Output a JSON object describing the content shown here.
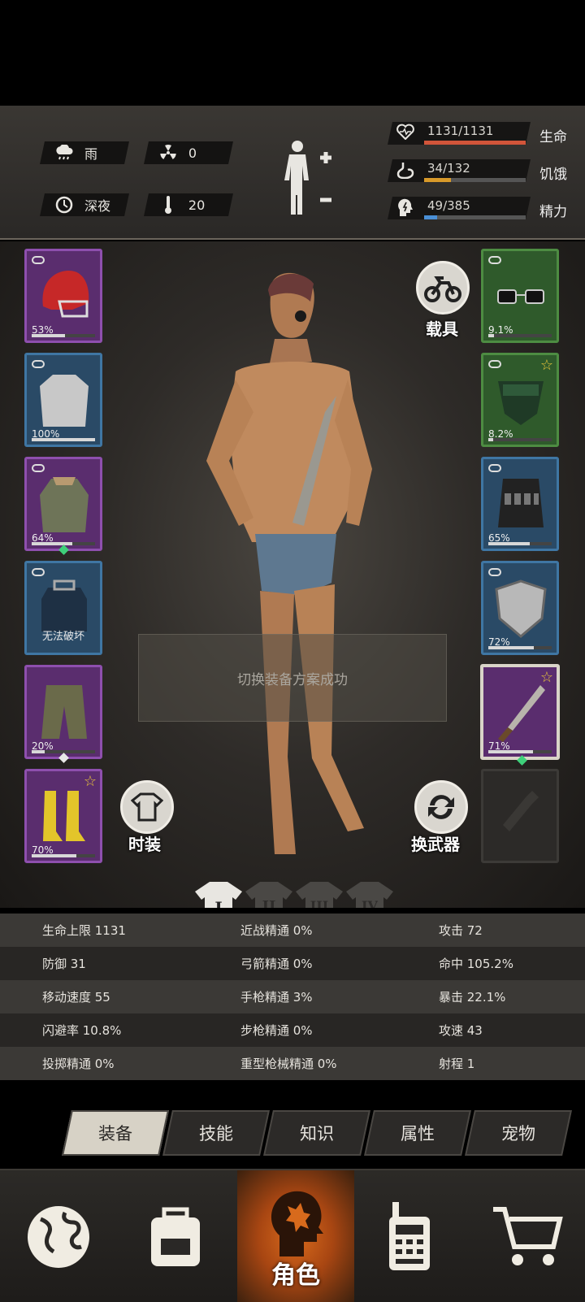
{
  "environment": {
    "weather": "雨",
    "radiation": "0",
    "time_of_day": "深夜",
    "temperature": "20"
  },
  "vitals": [
    {
      "label": "生命",
      "value": "1131/1131",
      "fraction": 1.0,
      "color": "#d2553a",
      "icon": "heart-icon"
    },
    {
      "label": "饥饿",
      "value": "34/132",
      "fraction": 0.26,
      "color": "#d89a2a",
      "icon": "stomach-icon"
    },
    {
      "label": "精力",
      "value": "49/385",
      "fraction": 0.13,
      "color": "#4a8fd6",
      "icon": "head-energy-icon"
    }
  ],
  "left_slots": [
    {
      "name": "helmet",
      "pct": "53%",
      "durability": 0.53,
      "rarity": "purple",
      "icon": "football-helmet-icon"
    },
    {
      "name": "shirt",
      "pct": "100%",
      "durability": 1.0,
      "rarity": "blue",
      "icon": "shirt-icon"
    },
    {
      "name": "jacket",
      "pct": "64%",
      "durability": 0.64,
      "rarity": "purple",
      "icon": "parka-icon"
    },
    {
      "name": "backpack",
      "pct": "",
      "text": "无法破坏",
      "rarity": "blue",
      "icon": "backpack-icon"
    },
    {
      "name": "pants",
      "pct": "20%",
      "durability": 0.2,
      "rarity": "purple",
      "icon": "pants-icon"
    },
    {
      "name": "boots",
      "pct": "70%",
      "durability": 0.7,
      "rarity": "purple",
      "icon": "boots-icon"
    }
  ],
  "right_slots": [
    {
      "name": "glasses",
      "pct": "9.1%",
      "durability": 0.09,
      "rarity": "green",
      "icon": "glasses-icon"
    },
    {
      "name": "mask",
      "pct": "8.2%",
      "durability": 0.08,
      "rarity": "green",
      "icon": "mask-icon"
    },
    {
      "name": "vest",
      "pct": "65%",
      "durability": 0.65,
      "rarity": "blue",
      "icon": "tactical-vest-icon"
    },
    {
      "name": "shield",
      "pct": "72%",
      "durability": 0.72,
      "rarity": "blue",
      "icon": "shield-icon"
    },
    {
      "name": "machete",
      "pct": "71%",
      "durability": 0.71,
      "rarity": "purple",
      "icon": "machete-icon"
    }
  ],
  "buttons": {
    "vehicle": "载具",
    "fashion": "时装",
    "switch_weapon": "换武器"
  },
  "toast": "切换装备方案成功",
  "presets": [
    "I",
    "II",
    "III",
    "IV"
  ],
  "stats": [
    [
      "生命上限 1131",
      "近战精通 0%",
      "攻击 72"
    ],
    [
      "防御 31",
      "弓箭精通 0%",
      "命中 105.2%"
    ],
    [
      "移动速度 55",
      "手枪精通 3%",
      "暴击 22.1%"
    ],
    [
      "闪避率 10.8%",
      "步枪精通 0%",
      "攻速 43"
    ],
    [
      "投掷精通 0%",
      "重型枪械精通 0%",
      "射程 1"
    ]
  ],
  "sub_tabs": [
    "装备",
    "技能",
    "知识",
    "属性",
    "宠物"
  ],
  "nav": {
    "world": "world-globe-icon",
    "inventory": "backpack-icon",
    "character": "角色",
    "radio": "walkie-talkie-icon",
    "shop": "cart-icon"
  }
}
